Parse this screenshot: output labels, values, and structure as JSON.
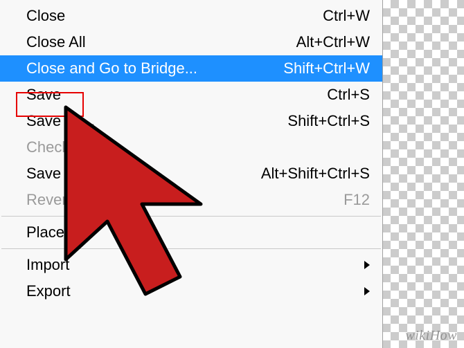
{
  "menu": {
    "items": [
      {
        "label": "Close",
        "shortcut": "Ctrl+W",
        "enabled": true,
        "highlighted": false,
        "hasSubmenu": false
      },
      {
        "label": "Close All",
        "shortcut": "Alt+Ctrl+W",
        "enabled": true,
        "highlighted": false,
        "hasSubmenu": false
      },
      {
        "label": "Close and Go to Bridge...",
        "shortcut": "Shift+Ctrl+W",
        "enabled": true,
        "highlighted": true,
        "hasSubmenu": false
      },
      {
        "label": "Save",
        "shortcut": "Ctrl+S",
        "enabled": true,
        "highlighted": false,
        "hasSubmenu": false
      },
      {
        "label": "Save As...",
        "shortcut": "Shift+Ctrl+S",
        "enabled": true,
        "highlighted": false,
        "hasSubmenu": false
      },
      {
        "label": "Check In...",
        "shortcut": "",
        "enabled": false,
        "highlighted": false,
        "hasSubmenu": false
      },
      {
        "label": "Save for Web...",
        "shortcut": "Alt+Shift+Ctrl+S",
        "enabled": true,
        "highlighted": false,
        "hasSubmenu": false
      },
      {
        "label": "Revert",
        "shortcut": "F12",
        "enabled": false,
        "highlighted": false,
        "hasSubmenu": false
      },
      {
        "separator": true
      },
      {
        "label": "Place...",
        "shortcut": "",
        "enabled": true,
        "highlighted": false,
        "hasSubmenu": false
      },
      {
        "separator": true
      },
      {
        "label": "Import",
        "shortcut": "",
        "enabled": true,
        "highlighted": false,
        "hasSubmenu": true
      },
      {
        "label": "Export",
        "shortcut": "",
        "enabled": true,
        "highlighted": false,
        "hasSubmenu": true
      }
    ]
  },
  "annotation": {
    "boxed_item": "Save",
    "cursor_color": "#c81e1e",
    "cursor_stroke": "#000000"
  },
  "watermark": "wikiHow"
}
